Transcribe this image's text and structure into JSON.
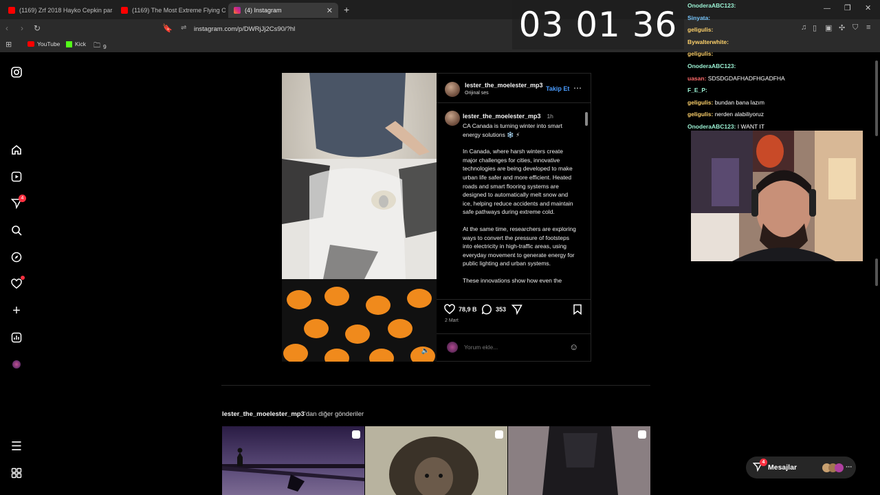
{
  "browser": {
    "tabs": [
      {
        "title": "(1169) Zrf 2018 Hayko Cepkin parağ",
        "color": "#ff0000"
      },
      {
        "title": "(1169) The Most Extreme Flying Obs",
        "color": "#ff0000"
      },
      {
        "title": "(4) Instagram",
        "color": "#e1306c"
      }
    ],
    "new_tab": "+",
    "url": "instagram.com/p/DWRjJj2Cs90/?hl",
    "bookmarks": [
      {
        "label": "YouTube"
      },
      {
        "label": "Kick"
      },
      {
        "label": "9"
      }
    ]
  },
  "sidebar": {
    "notifications_badge": "4"
  },
  "post": {
    "header_username": "lester_the_moelester_mp3",
    "header_subtitle": "Orijinal ses",
    "follow_label": "Takip Et",
    "caption_username": "lester_the_moelester_mp3",
    "caption_time": "1h",
    "caption_first": "CA Canada is turning winter into smart energy solutions ❄️ ⚡",
    "caption_p1": "In Canada, where harsh winters create major challenges for cities, innovative technologies are being developed to make urban life safer and more efficient. Heated roads and smart flooring systems are designed to automatically melt snow and ice, helping reduce accidents and maintain safe pathways during extreme cold.",
    "caption_p2": "At the same time, researchers are exploring ways to convert the pressure of footsteps into electricity in high-traffic areas, using everyday movement to generate energy for public lighting and urban systems.",
    "caption_p3": "These innovations show how even the",
    "likes": "78,9 B",
    "comments": "353",
    "date": "2 Mart",
    "comment_placeholder": "Yorum ekle..."
  },
  "more_posts": {
    "username": "lester_the_moelester_mp3",
    "suffix": "'dan diğer gönderiler"
  },
  "messages_bar": {
    "label": "Mesajlar",
    "badge": "4"
  },
  "overlay": {
    "timer": "03 01 36",
    "chat": [
      {
        "user": "OnoderaABC123:",
        "msg": "",
        "cls": "u1"
      },
      {
        "user": "Sinyata:",
        "msg": "",
        "cls": "u2"
      },
      {
        "user": "geligulis:",
        "msg": "",
        "cls": "u3"
      },
      {
        "user": "Bywalterwhite:",
        "msg": "",
        "cls": "u3"
      },
      {
        "user": "geligulis:",
        "msg": "",
        "cls": "u3"
      },
      {
        "user": "OnoderaABC123:",
        "msg": "",
        "cls": "u1"
      },
      {
        "user": "uasan:",
        "msg": "SDSDGDAFHADFHGADFHA",
        "cls": "u4"
      },
      {
        "user": "F_E_P:",
        "msg": "",
        "cls": "u1"
      },
      {
        "user": "geligulis:",
        "msg": "bundan bana lazım",
        "cls": "u3"
      },
      {
        "user": "geligulis:",
        "msg": "nerden alabiliyoruz",
        "cls": "u3"
      },
      {
        "user": "OnoderaABC123:",
        "msg": "I WANT IT",
        "cls": "u1"
      }
    ]
  }
}
